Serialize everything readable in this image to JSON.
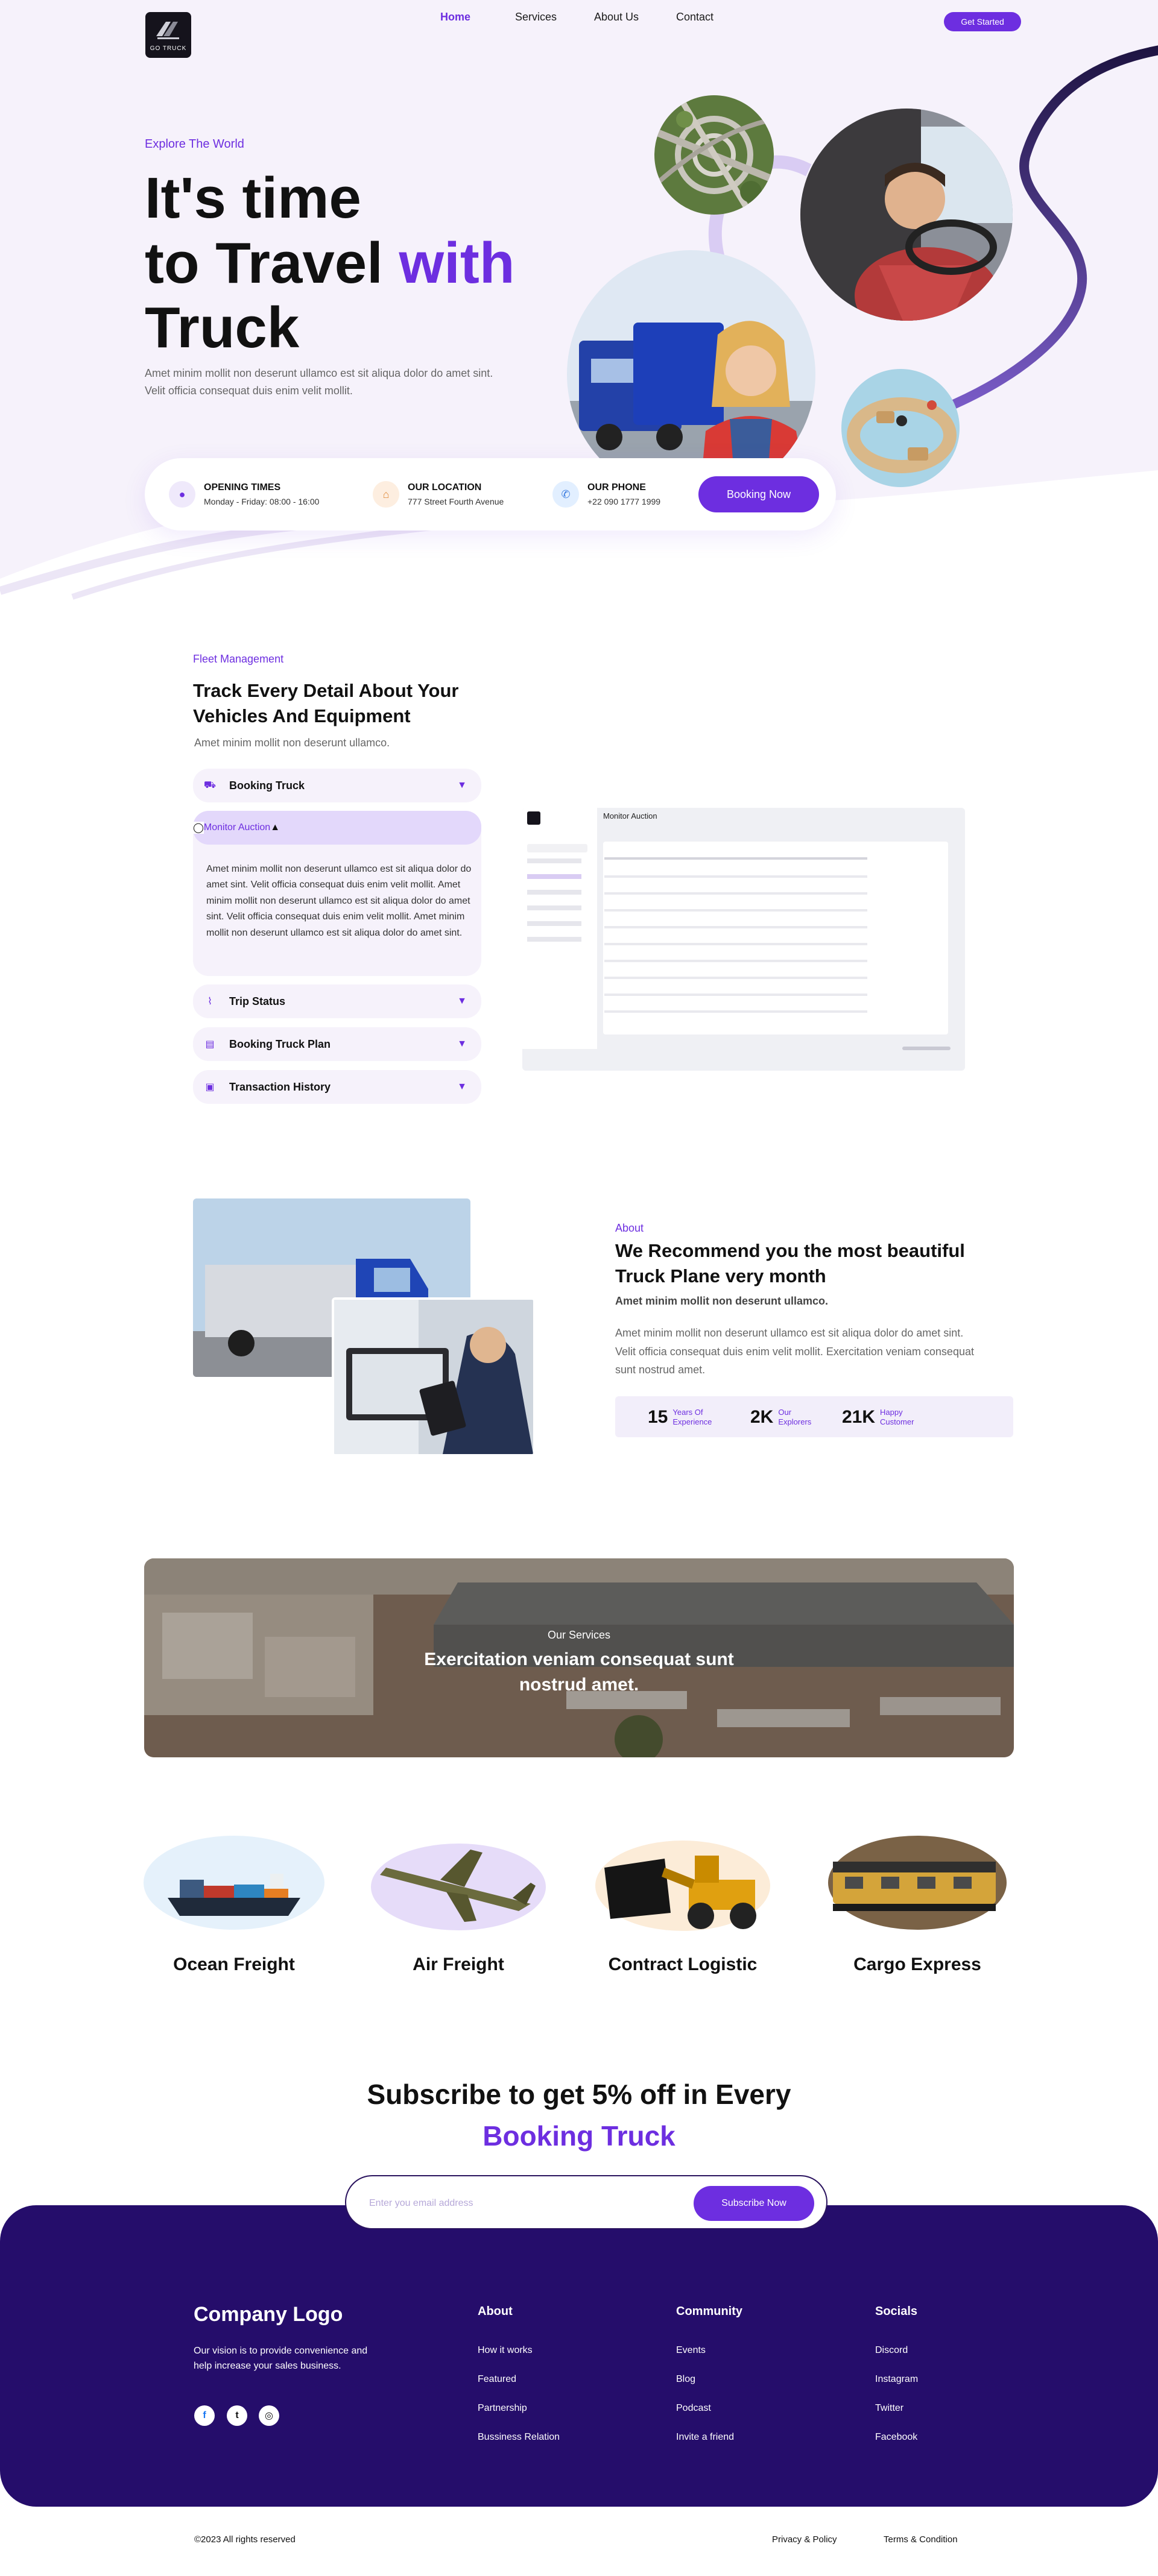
{
  "header": {
    "logo_text": "GO TRUCK",
    "nav": [
      "Home",
      "Services",
      "About Us",
      "Contact"
    ],
    "cta": "Get Started"
  },
  "hero": {
    "eyebrow": "Explore The World",
    "title_line1": "It's time",
    "title_line2a": "to Travel ",
    "title_line2b": "with",
    "title_line3": "Truck",
    "description": "Amet minim mollit non deserunt ullamco est sit aliqua dolor do amet sint. Velit officia consequat duis enim velit mollit."
  },
  "info": {
    "hours_title": "OPENING TIMES",
    "hours_value": "Monday - Friday: 08:00 - 16:00",
    "location_title": "OUR LOCATION",
    "location_value": "777 Street Fourth Avenue",
    "phone_title": "OUR PHONE",
    "phone_value": "+22 090 1777 1999",
    "booking_button": "Booking Now"
  },
  "fleet": {
    "eyebrow": "Fleet Management",
    "title": "Track Every Detail About Your Vehicles And Equipment",
    "description": "Amet minim mollit non deserunt ullamco.",
    "items": [
      "Booking Truck",
      "Monitor Auction",
      "Trip Status",
      "Booking Truck Plan",
      "Transaction History"
    ],
    "open_body": "Amet minim mollit non deserunt ullamco est sit aliqua dolor do amet sint. Velit officia consequat duis enim velit mollit. Amet minim mollit non deserunt ullamco est sit aliqua dolor do amet sint. Velit officia consequat duis enim velit mollit. Amet minim mollit non deserunt ullamco est sit aliqua dolor do amet sint.",
    "dashboard_title": "Monitor Auction"
  },
  "recommend": {
    "eyebrow": "About",
    "title": "We Recommend you the most beautiful Truck Plane very month",
    "subtitle": "Amet minim mollit non deserunt ullamco.",
    "description": "Amet minim mollit non deserunt ullamco est sit aliqua dolor do amet sint. Velit officia consequat duis enim velit mollit. Exercitation veniam consequat sunt nostrud amet.",
    "stats": [
      {
        "value": "15",
        "label_1": "Years Of",
        "label_2": "Experience"
      },
      {
        "value": "2K",
        "label_1": "Our",
        "label_2": "Explorers"
      },
      {
        "value": "21K",
        "label_1": "Happy",
        "label_2": "Customer"
      }
    ]
  },
  "services_banner": {
    "eyebrow": "Our Services",
    "title": "Exercitation veniam consequat sunt nostrud amet."
  },
  "services": [
    "Ocean Freight",
    "Air Freight",
    "Contract Logistic",
    "Cargo Express"
  ],
  "subscribe": {
    "title_line1": "Subscribe to get 5% off in Every",
    "title_line2": "Booking Truck",
    "placeholder": "Enter you email address",
    "button": "Subscribe Now"
  },
  "footer": {
    "logo": "Company Logo",
    "vision": "Our vision is to provide convenience and help increase your sales business.",
    "about_head": "About",
    "about_links": [
      "How it works",
      "Featured",
      "Partnership",
      "Bussiness Relation"
    ],
    "community_head": "Community",
    "community_links": [
      "Events",
      "Blog",
      "Podcast",
      "Invite a friend"
    ],
    "socials_head": "Socials",
    "socials_links": [
      "Discord",
      "Instagram",
      "Twitter",
      "Facebook"
    ],
    "copyright": "©2023  All rights reserved",
    "privacy": "Privacy & Policy",
    "terms": "Terms & Condition"
  },
  "colors": {
    "accent": "#6d2ee0",
    "footer": "#250d6b",
    "hero_bg": "#f6f2fb"
  }
}
